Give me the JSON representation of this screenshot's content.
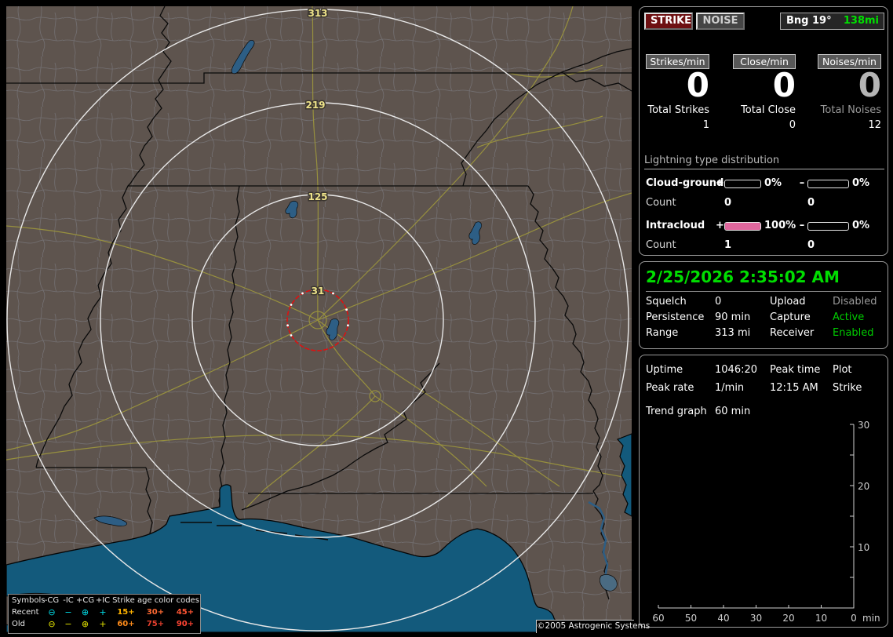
{
  "panel": {
    "strike_button": "STRIKE",
    "noise_button": "NOISE",
    "bearing": {
      "label": "Bng 19°",
      "value": "138mi",
      "value_color": "#00e100"
    },
    "rates": [
      {
        "label": "Strikes/min",
        "value": "0",
        "value_color": "#ffffff"
      },
      {
        "label": "Close/min",
        "value": "0",
        "value_color": "#ffffff"
      },
      {
        "label": "Noises/min",
        "value": "0",
        "value_color": "#b4b4b4"
      }
    ],
    "totals": [
      {
        "label": "Total Strikes",
        "label_color": "#ffffff",
        "value": "1"
      },
      {
        "label": "Total Close",
        "label_color": "#ffffff",
        "value": "0"
      },
      {
        "label": "Total Noises",
        "label_color": "#9a9a9a",
        "value": "12"
      }
    ],
    "distribution": {
      "title": "Lightning type distribution",
      "plus_sign": "+",
      "minus_sign": "–",
      "bar_fill_color": "#e0679d",
      "rows": [
        {
          "label": "Cloud-ground",
          "plus_pct": "0%",
          "plus_fill": 0,
          "minus_pct": "0%",
          "minus_fill": 0,
          "count_label": "Count",
          "plus_count": "0",
          "minus_count": "0"
        },
        {
          "label": "Intracloud",
          "plus_pct": "100%",
          "plus_fill": 100,
          "minus_pct": "0%",
          "minus_fill": 0,
          "count_label": "Count",
          "plus_count": "1",
          "minus_count": "0"
        }
      ]
    }
  },
  "status": {
    "datetime": "2/25/2026 2:35:02 AM",
    "rows": [
      {
        "label": "Squelch",
        "value": "0",
        "label2": "Upload",
        "value2": "Disabled",
        "value2_color": "#9a9a9a"
      },
      {
        "label": "Persistence",
        "value": "90 min",
        "label2": "Capture",
        "value2": "Active",
        "value2_color": "#00cc00"
      },
      {
        "label": "Range",
        "value": "313 mi",
        "label2": "Receiver",
        "value2": "Enabled",
        "value2_color": "#00cc00"
      }
    ]
  },
  "stats": {
    "rows": [
      {
        "label": "Uptime",
        "value": "1046:20",
        "label2": "Peak time",
        "value2": "Plot"
      },
      {
        "label": "Peak rate",
        "value": "1/min",
        "label2": "12:15 AM",
        "value2": "Strike"
      }
    ],
    "trend_label": "Trend graph",
    "trend_value": "60 min"
  },
  "chart_data": {
    "type": "line",
    "title": "Trend graph (60 min)",
    "x_ticks": [
      "60",
      "50",
      "40",
      "30",
      "20",
      "10",
      "0"
    ],
    "x_unit": "min",
    "y_ticks": [
      "30",
      "20",
      "10"
    ],
    "ylim": [
      0,
      30
    ],
    "xlim_minutes_ago": [
      60,
      0
    ],
    "grid": false,
    "series": []
  },
  "map": {
    "ring_labels": {
      "outer": "313",
      "middle": "219",
      "inner": "125",
      "alert": "31"
    },
    "copyright": "©2005 Astrogenic Systems",
    "legend": {
      "headers": {
        "symbols": "Symbols",
        "ncg": "-CG",
        "nic": "-IC",
        "pcg": "+CG",
        "pic": "+IC",
        "age": "Strike age color codes"
      },
      "symbols": {
        "circle_minus": "⊖",
        "minus": "−",
        "circle_plus": "⊕",
        "plus": "+"
      },
      "rows": [
        {
          "label": "Recent",
          "symbol_color": "#00dde8",
          "ages": [
            {
              "text": "15+",
              "color": "#ffb300"
            },
            {
              "text": "30+",
              "color": "#ff6a33"
            },
            {
              "text": "45+",
              "color": "#ff5533"
            }
          ]
        },
        {
          "label": "Old",
          "symbol_color": "#e8e800",
          "ages": [
            {
              "text": "60+",
              "color": "#ff8c1a"
            },
            {
              "text": "75+",
              "color": "#e8402e"
            },
            {
              "text": "90+",
              "color": "#ff4433"
            }
          ]
        }
      ]
    }
  }
}
